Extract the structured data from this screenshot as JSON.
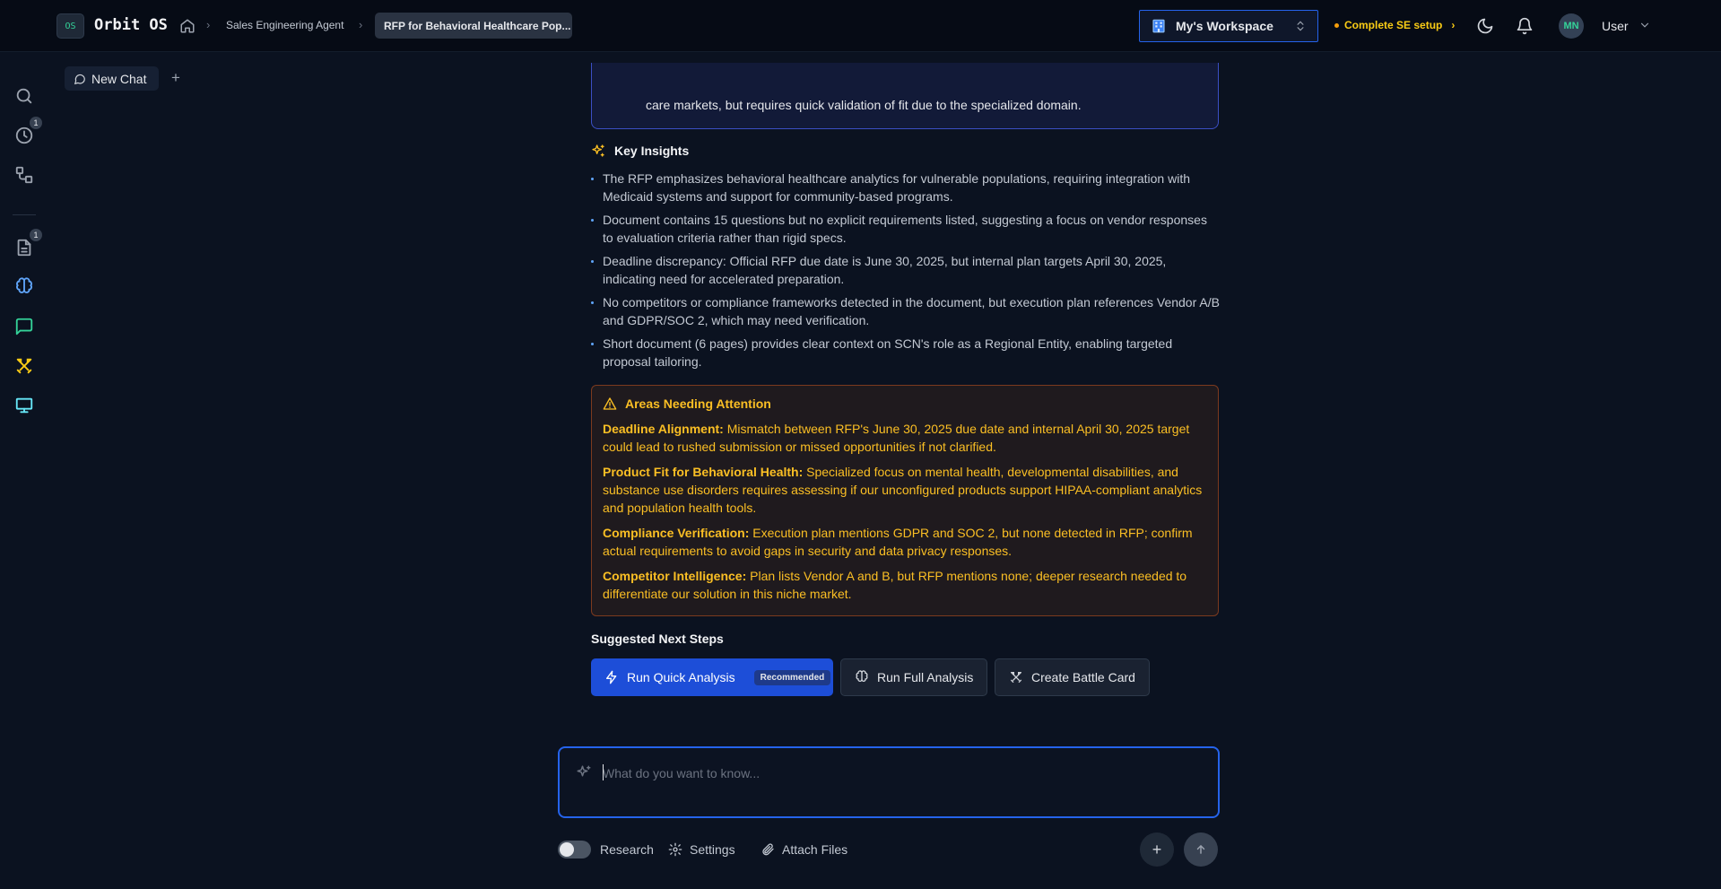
{
  "app": {
    "logo_badge": "OS",
    "name": "Orbit OS"
  },
  "breadcrumb": {
    "items": [
      "Sales Engineering Agent",
      "RFP for Behavioral Healthcare Pop..."
    ]
  },
  "header": {
    "workspace_label": "My's Workspace",
    "setup_label": "Complete SE setup",
    "avatar_initials": "MN",
    "user_label": "User"
  },
  "rail": {
    "history_badge": "1",
    "documents_badge": "1"
  },
  "chat_tab": {
    "label": "New Chat"
  },
  "summary": {
    "tail_text": "care markets, but requires quick validation of fit due to the specialized domain."
  },
  "key_insights": {
    "title": "Key Insights",
    "items": [
      "The RFP emphasizes behavioral healthcare analytics for vulnerable populations, requiring integration with Medicaid systems and support for community-based programs.",
      "Document contains 15 questions but no explicit requirements listed, suggesting a focus on vendor responses to evaluation criteria rather than rigid specs.",
      "Deadline discrepancy: Official RFP due date is June 30, 2025, but internal plan targets April 30, 2025, indicating need for accelerated preparation.",
      "No competitors or compliance frameworks detected in the document, but execution plan references Vendor A/B and GDPR/SOC 2, which may need verification.",
      "Short document (6 pages) provides clear context on SCN's role as a Regional Entity, enabling targeted proposal tailoring."
    ]
  },
  "attention": {
    "title": "Areas Needing Attention",
    "items": [
      {
        "label": "Deadline Alignment:",
        "text": " Mismatch between RFP's June 30, 2025 due date and internal April 30, 2025 target could lead to rushed submission or missed opportunities if not clarified."
      },
      {
        "label": "Product Fit for Behavioral Health:",
        "text": " Specialized focus on mental health, developmental disabilities, and substance use disorders requires assessing if our unconfigured products support HIPAA-compliant analytics and population health tools."
      },
      {
        "label": "Compliance Verification:",
        "text": " Execution plan mentions GDPR and SOC 2, but none detected in RFP; confirm actual requirements to avoid gaps in security and data privacy responses."
      },
      {
        "label": "Competitor Intelligence:",
        "text": " Plan lists Vendor A and B, but RFP mentions none; deeper research needed to differentiate our solution in this niche market."
      }
    ]
  },
  "next_steps": {
    "title": "Suggested Next Steps",
    "quick_label": "Run Quick Analysis",
    "recommended_label": "Recommended",
    "full_label": "Run Full Analysis",
    "battle_label": "Create Battle Card"
  },
  "composer": {
    "placeholder": "What do you want to know...",
    "research_label": "Research",
    "research_enabled": false,
    "settings_label": "Settings",
    "attach_label": "Attach Files"
  },
  "colors": {
    "accent": "#2563eb",
    "warning": "#fbbf24",
    "success": "#34d399"
  }
}
